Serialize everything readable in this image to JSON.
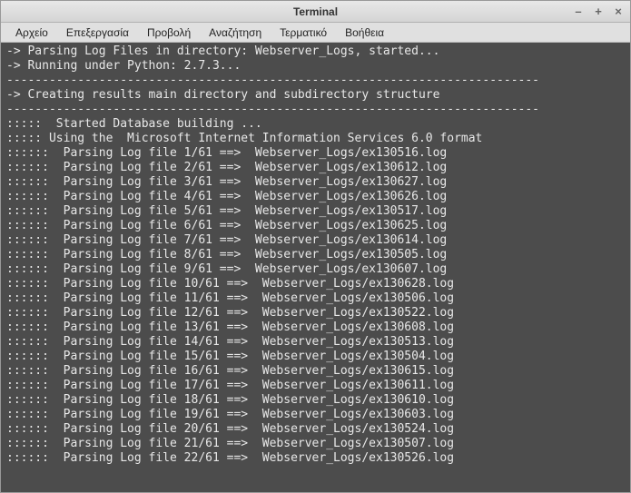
{
  "window": {
    "title": "Terminal",
    "controls": {
      "min": "–",
      "max": "+",
      "close": "×"
    }
  },
  "menubar": {
    "items": [
      "Αρχείο",
      "Επεξεργασία",
      "Προβολή",
      "Αναζήτηση",
      "Τερματικό",
      "Βοήθεια"
    ]
  },
  "terminal": {
    "header_lines": [
      "-> Parsing Log Files in directory: Webserver_Logs, started...",
      "-> Running under Python: 2.7.3...",
      "---------------------------------------------------------------------------",
      "-> Creating results main directory and subdirectory structure",
      "---------------------------------------------------------------------------",
      ":::::  Started Database building ...",
      "::::: Using the  Microsoft Internet Information Services 6.0 format"
    ],
    "parse_prefix": "::::::  Parsing Log file ",
    "parse_total": 61,
    "parse_arrow": " ==>  ",
    "parse_dir": "Webserver_Logs/",
    "files": [
      "ex130516.log",
      "ex130612.log",
      "ex130627.log",
      "ex130626.log",
      "ex130517.log",
      "ex130625.log",
      "ex130614.log",
      "ex130505.log",
      "ex130607.log",
      "ex130628.log",
      "ex130506.log",
      "ex130522.log",
      "ex130608.log",
      "ex130513.log",
      "ex130504.log",
      "ex130615.log",
      "ex130611.log",
      "ex130610.log",
      "ex130603.log",
      "ex130524.log",
      "ex130507.log",
      "ex130526.log"
    ]
  }
}
